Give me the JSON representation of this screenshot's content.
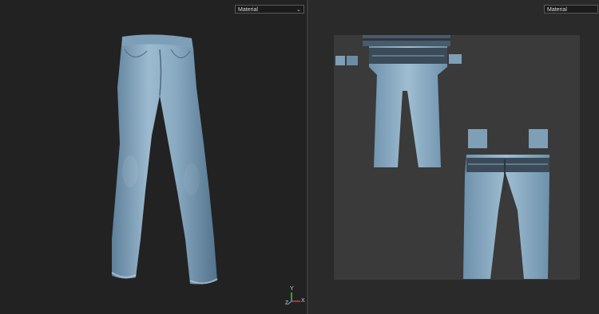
{
  "viewport_3d": {
    "shading_mode": "Material",
    "axis_labels": {
      "y": "Y",
      "x": "X",
      "z": "Z"
    }
  },
  "viewport_uv": {
    "shading_mode": "Material"
  },
  "colors": {
    "denim_light": "#8fb1c8",
    "denim_mid": "#6d91ab",
    "denim_dark": "#3e5a70",
    "uv_background": "#3a3a3a",
    "viewport_background": "#222222"
  }
}
